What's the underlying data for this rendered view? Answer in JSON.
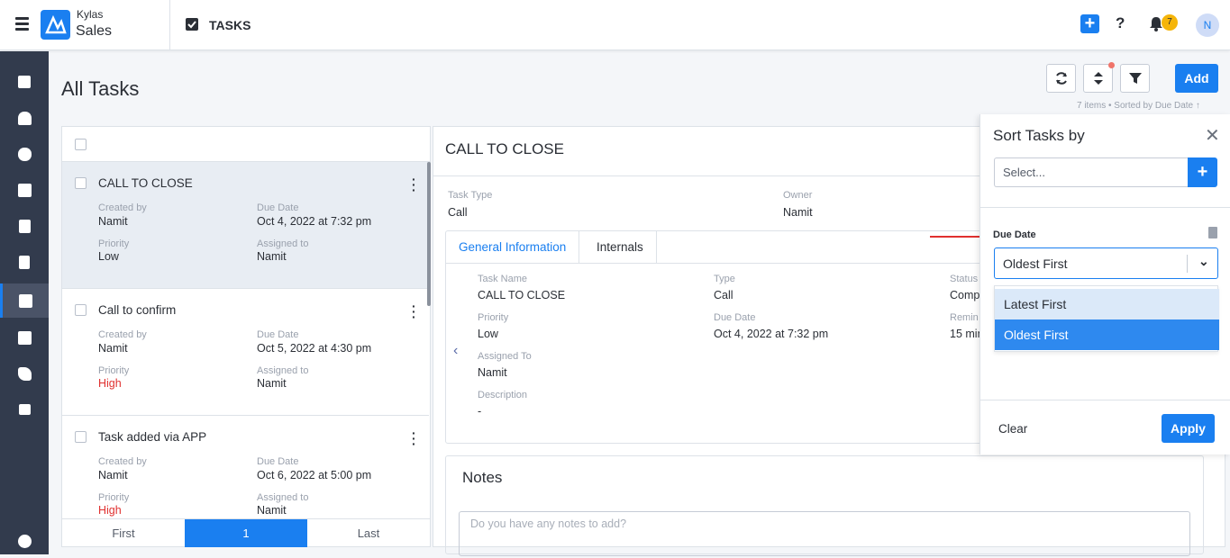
{
  "topbar": {
    "brand_top": "Kylas",
    "brand_bottom": "Sales",
    "module": "TASKS",
    "help": "?",
    "notif_count": "7",
    "avatar": "N"
  },
  "page": {
    "title": "All Tasks",
    "add_label": "Add",
    "meta": "7 items • Sorted by  Due Date ↑"
  },
  "tasks": [
    {
      "title": "CALL TO CLOSE",
      "created_by_label": "Created by",
      "created_by": "Namit",
      "due_label": "Due Date",
      "due": "Oct 4, 2022 at 7:32 pm",
      "priority_label": "Priority",
      "priority": "Low",
      "assigned_label": "Assigned to",
      "assigned": "Namit"
    },
    {
      "title": "Call to confirm",
      "created_by_label": "Created by",
      "created_by": "Namit",
      "due_label": "Due Date",
      "due": "Oct 5, 2022 at 4:30 pm",
      "priority_label": "Priority",
      "priority": "High",
      "assigned_label": "Assigned to",
      "assigned": "Namit"
    },
    {
      "title": "Task added via APP",
      "created_by_label": "Created by",
      "created_by": "Namit",
      "due_label": "Due Date",
      "due": "Oct 6, 2022 at 5:00 pm",
      "priority_label": "Priority",
      "priority": "High",
      "assigned_label": "Assigned to",
      "assigned": "Namit"
    }
  ],
  "pager": {
    "first": "First",
    "current": "1",
    "last": "Last"
  },
  "detail": {
    "title": "CALL TO CLOSE",
    "task_type_label": "Task Type",
    "task_type": "Call",
    "owner_label": "Owner",
    "owner": "Namit",
    "tabs": [
      "General Information",
      "Internals"
    ],
    "task_name_label": "Task Name",
    "task_name": "CALL TO CLOSE",
    "type_label": "Type",
    "type": "Call",
    "status_label": "Status",
    "status": "Comp",
    "priority_label": "Priority",
    "priority": "Low",
    "due_label": "Due Date",
    "due": "Oct 4, 2022 at 7:32 pm",
    "reminder_label": "Remin",
    "reminder": "15 min",
    "assigned_label": "Assigned To",
    "assigned": "Namit",
    "description_label": "Description",
    "description": "-",
    "notes_title": "Notes",
    "notes_placeholder": "Do you have any notes to add?"
  },
  "sort": {
    "title": "Sort Tasks by",
    "select_placeholder": "Select...",
    "field_label": "Due Date",
    "selected": "Oldest First",
    "options": [
      "Latest First",
      "Oldest First"
    ],
    "clear": "Clear",
    "apply": "Apply"
  },
  "colors": {
    "accent": "#1a7ff0",
    "sidebar": "#323b4d",
    "high_priority": "#e0302f",
    "badge": "#f5b50a"
  }
}
